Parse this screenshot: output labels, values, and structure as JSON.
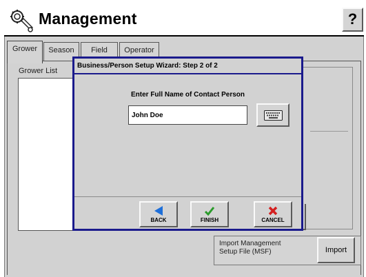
{
  "header": {
    "title": "Management",
    "help_label": "?"
  },
  "tabs": [
    {
      "label": "Grower",
      "active": true
    },
    {
      "label": "Season",
      "active": false
    },
    {
      "label": "Field",
      "active": false
    },
    {
      "label": "Operator",
      "active": false
    }
  ],
  "grower_list": {
    "label": "Grower List"
  },
  "import": {
    "label": "Import Management\nSetup File (MSF)",
    "button_label": "Import"
  },
  "dialog": {
    "title": "Business/Person Setup Wizard:  Step 2 of 2",
    "prompt": "Enter Full Name of Contact Person",
    "name_value": "John Doe",
    "buttons": {
      "back": "BACK",
      "finish": "FINISH",
      "cancel": "CANCEL"
    }
  },
  "colors": {
    "dialog_border": "#1a1a8c",
    "back_icon": "#1e6fd9",
    "finish_icon": "#2a9b2a",
    "cancel_icon": "#d42020"
  },
  "icons": {
    "app": "wrench-gear-icon",
    "keyboard": "keyboard-icon",
    "back": "arrow-left-icon",
    "finish": "checkmark-icon",
    "cancel": "x-icon"
  }
}
